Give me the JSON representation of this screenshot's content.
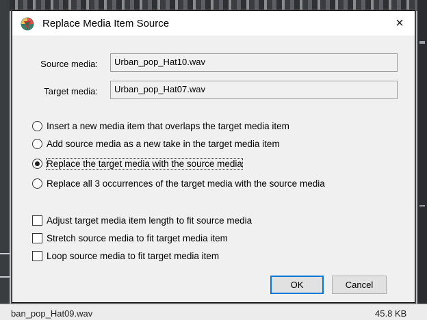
{
  "dialog": {
    "title": "Replace Media Item Source",
    "close_glyph": "×",
    "source_label": "Source media:",
    "source_value": "Urban_pop_Hat10.wav",
    "target_label": "Target media:",
    "target_value": "Urban_pop_Hat07.wav",
    "radio_options": [
      {
        "label": "Insert a new media item that overlaps the target media item",
        "selected": false
      },
      {
        "label": "Add source media as a new take in the target media item",
        "selected": false
      },
      {
        "label": "Replace the target media with the source media",
        "selected": true
      },
      {
        "label": "Replace all 3 occurrences of the target media with the source media",
        "selected": false
      }
    ],
    "check_options": [
      {
        "label": "Adjust target media item length to fit source media",
        "checked": false
      },
      {
        "label": "Stretch source media to fit target media item",
        "checked": false
      },
      {
        "label": "Loop source media to fit target media item",
        "checked": false
      }
    ],
    "ok_label": "OK",
    "cancel_label": "Cancel",
    "accent_color": "#0078d7"
  },
  "background": {
    "bottom_file_name": "ban_pop_Hat09.wav",
    "bottom_file_size": "45.8 KB"
  }
}
